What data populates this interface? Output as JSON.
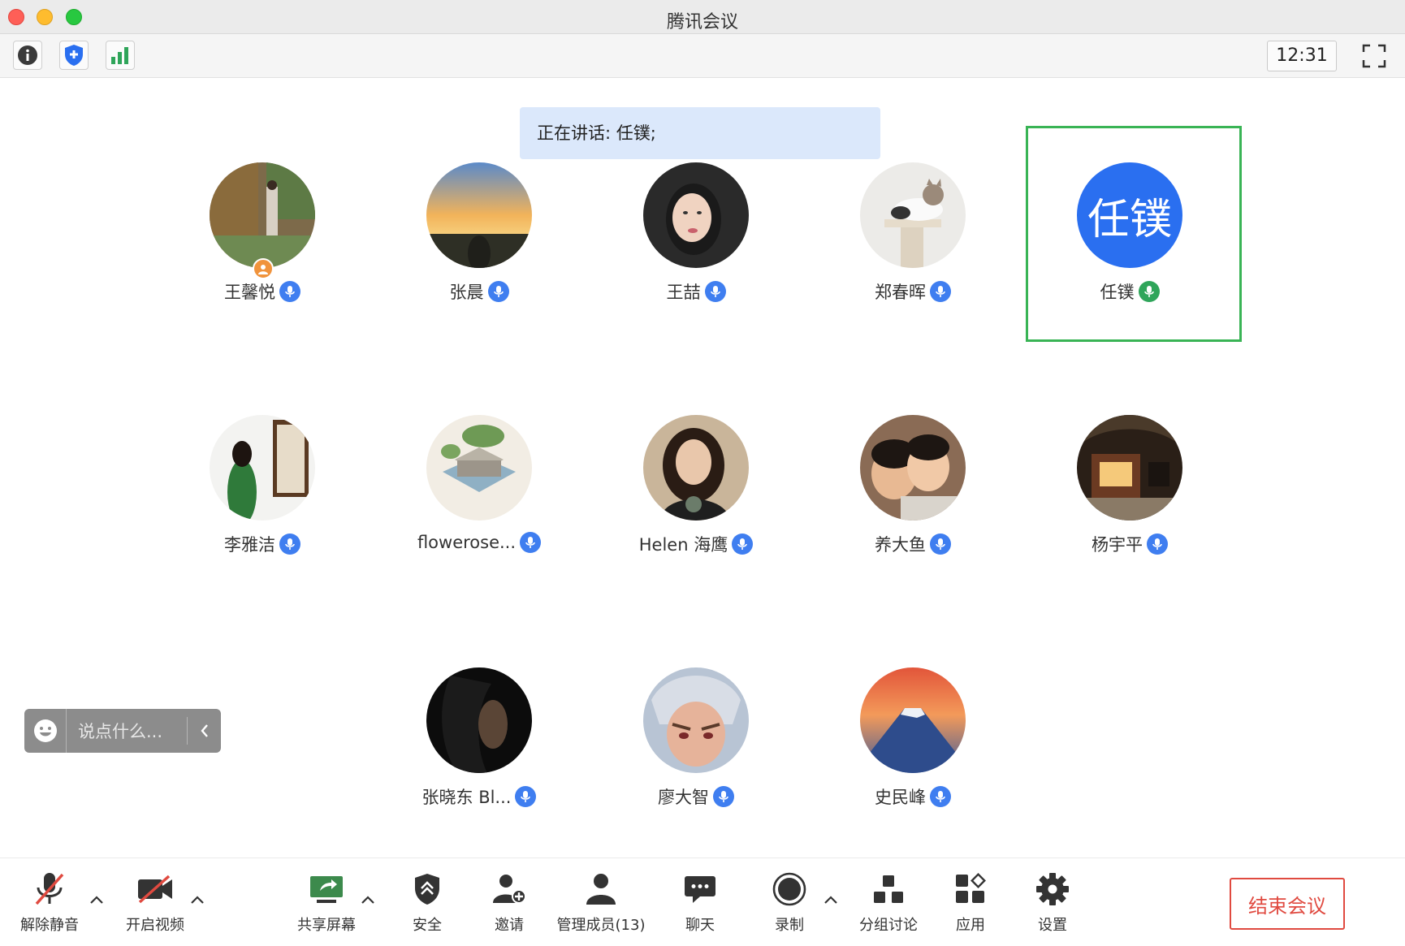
{
  "window": {
    "title": "腾讯会议"
  },
  "toolbar": {
    "clock": "12:31"
  },
  "speaking": {
    "text": "正在讲话: 任镤;"
  },
  "participants": [
    {
      "name": "王馨悦",
      "is_host": true
    },
    {
      "name": "张晨"
    },
    {
      "name": "王喆"
    },
    {
      "name": "郑春晖"
    },
    {
      "name": "任镤",
      "initials": "任镤",
      "speaking": true
    },
    {
      "name": "李雅洁"
    },
    {
      "name": "flowerose..."
    },
    {
      "name": "Helen 海鹰"
    },
    {
      "name": "养大鱼"
    },
    {
      "name": "杨宇平"
    },
    {
      "name": "张晓东 Bl..."
    },
    {
      "name": "廖大智"
    },
    {
      "name": "史民峰"
    }
  ],
  "chat": {
    "placeholder": "说点什么..."
  },
  "bottom": {
    "unmute": "解除静音",
    "start_video": "开启视频",
    "share_screen": "共享屏幕",
    "security": "安全",
    "invite": "邀请",
    "manage_members": "管理成员(13)",
    "chat": "聊天",
    "record": "录制",
    "breakout": "分组讨论",
    "apps": "应用",
    "settings": "设置",
    "end_meeting": "结束会议"
  },
  "colors": {
    "accent": "#2a6ff0",
    "speaking_border": "#39b455",
    "end": "#e04a40",
    "banner": "#dbe8fb"
  }
}
